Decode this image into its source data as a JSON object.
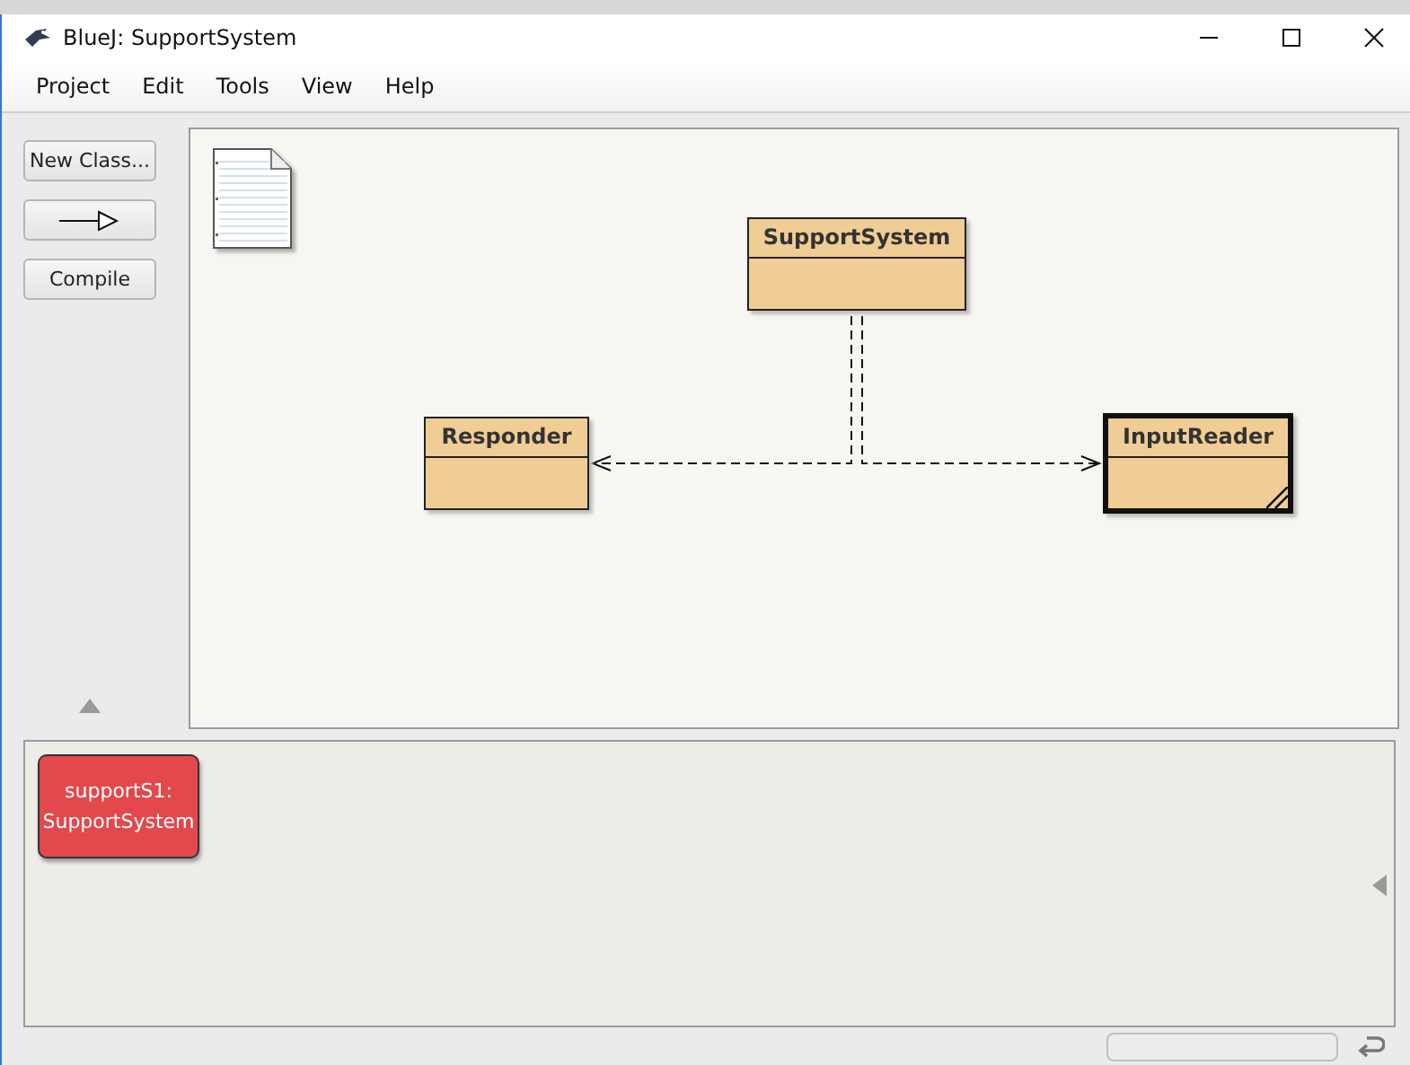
{
  "window": {
    "title": "BlueJ:  SupportSystem"
  },
  "menu": [
    "Project",
    "Edit",
    "Tools",
    "View",
    "Help"
  ],
  "toolbar": {
    "new_class": "New Class...",
    "compile": "Compile"
  },
  "classes": [
    {
      "name": "SupportSystem",
      "selected": false,
      "uncompiled": false
    },
    {
      "name": "Responder",
      "selected": false,
      "uncompiled": false
    },
    {
      "name": "InputReader",
      "selected": true,
      "uncompiled": true
    }
  ],
  "object_bench": [
    {
      "name": "supportS1:",
      "type": "SupportSystem"
    }
  ]
}
